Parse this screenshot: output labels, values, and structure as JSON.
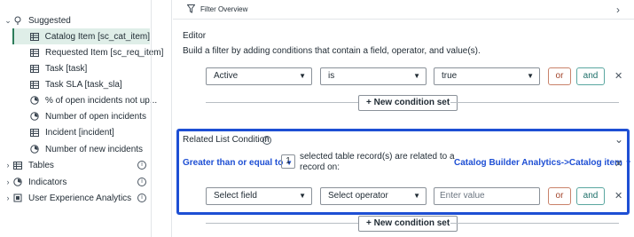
{
  "tree": {
    "suggested_label": "Suggested",
    "items": [
      {
        "label": "Catalog Item [sc_cat_item]",
        "icon": "table-icon",
        "selected": true
      },
      {
        "label": "Requested Item [sc_req_item]",
        "icon": "table-icon"
      },
      {
        "label": "Task [task]",
        "icon": "table-icon"
      },
      {
        "label": "Task SLA [task_sla]",
        "icon": "table-icon"
      },
      {
        "label": "% of open incidents not up...",
        "icon": "indicator-icon"
      },
      {
        "label": "Number of open incidents",
        "icon": "indicator-icon"
      },
      {
        "label": "Incident [incident]",
        "icon": "table-icon"
      },
      {
        "label": "Number of new incidents",
        "icon": "indicator-icon"
      }
    ],
    "groups": [
      {
        "label": "Tables"
      },
      {
        "label": "Indicators"
      },
      {
        "label": "User Experience Analytics"
      }
    ]
  },
  "filter_overview": {
    "label": "Filter Overview"
  },
  "editor": {
    "title": "Editor",
    "description": "Build a filter by adding conditions that contain a field, operator, and value(s).",
    "condition": {
      "field": "Active",
      "operator": "is",
      "value": "true"
    },
    "or_label": "or",
    "and_label": "and",
    "new_condition_set": "New condition set"
  },
  "related": {
    "title": "Related List Condition",
    "operator": "Greater than or equal to",
    "count": "1",
    "text_line1": "selected table record(s) are related to a",
    "text_line2": "record on:",
    "related_list": "Catalog Builder Analytics->Catalog item",
    "field_placeholder": "Select field",
    "operator_placeholder": "Select operator",
    "value_placeholder": "Enter value",
    "or_label": "or",
    "and_label": "and",
    "new_condition_set": "New condition set"
  },
  "colors": {
    "accent": "#1e4fd4",
    "or_border": "#c9826a",
    "and_border": "#5aa7a0",
    "selected_bg": "#dfeee8"
  }
}
